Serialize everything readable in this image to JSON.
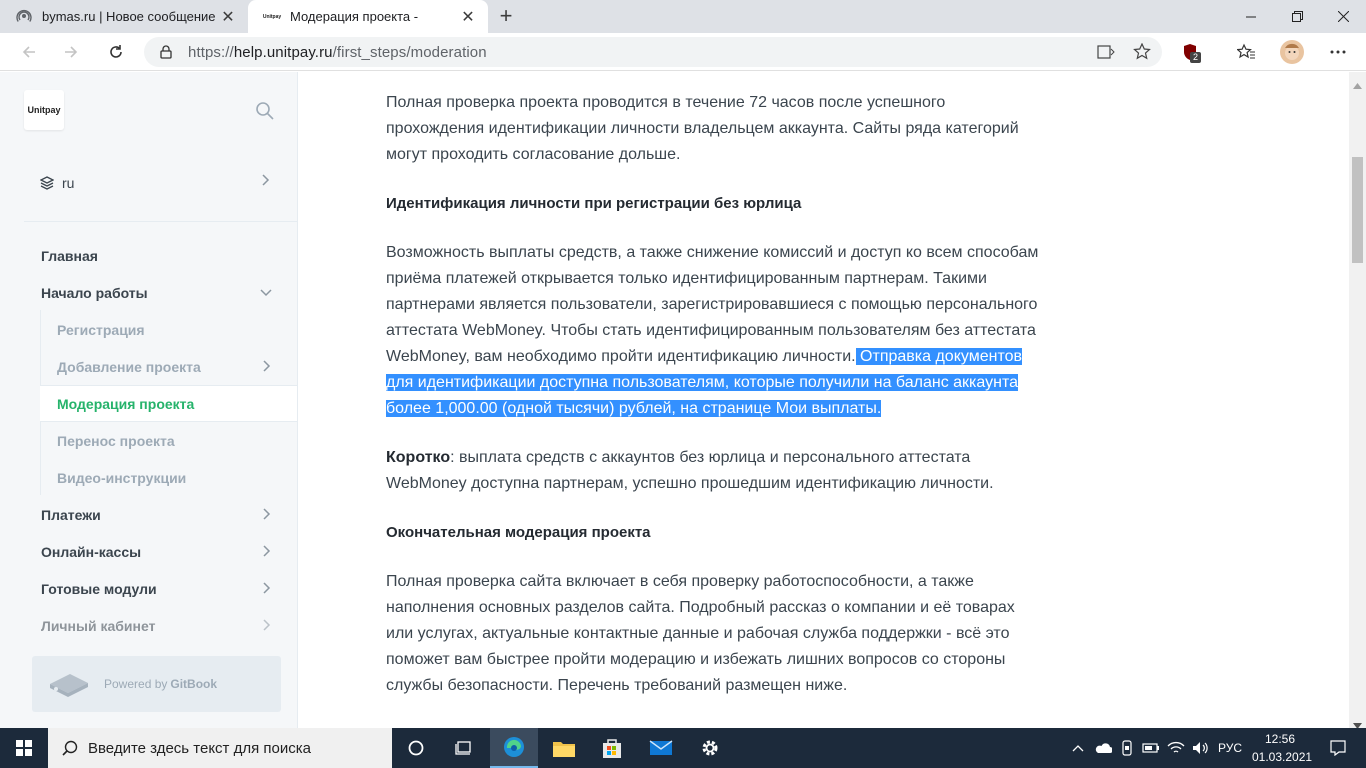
{
  "browser": {
    "tabs": [
      {
        "title": "bymas.ru | Новое сообщение"
      },
      {
        "title": "Модерация проекта -",
        "favicon_text": "Unitpay"
      }
    ],
    "url": {
      "scheme": "https://",
      "host": "help.unitpay.ru",
      "path": "/first_steps/moderation"
    },
    "extension_badge": "2"
  },
  "sidebar": {
    "logo_text": "Unitpay",
    "language": "ru",
    "items": [
      {
        "label": "Главная"
      },
      {
        "label": "Начало работы"
      },
      {
        "label": "Платежи"
      },
      {
        "label": "Онлайн-кассы"
      },
      {
        "label": "Готовые модули"
      },
      {
        "label": "Личный кабинет"
      }
    ],
    "subitems": [
      {
        "label": "Регистрация"
      },
      {
        "label": "Добавление проекта"
      },
      {
        "label": "Модерация проекта"
      },
      {
        "label": "Перенос проекта"
      },
      {
        "label": "Видео-инструкции"
      }
    ],
    "footer": {
      "prefix": "Powered by",
      "brand": "GitBook"
    }
  },
  "content": {
    "p1": "Полная проверка проекта проводится в течение 72 часов после успешного прохождения идентификации личности владельцем аккаунта. Сайты ряда категорий могут проходить согласование дольше.",
    "h1": "Идентификация личности при регистрации без юрлица",
    "p2_plain": "Возможность выплаты средств, а также снижение комиссий и доступ ко всем способам приёма платежей открывается только идентифицированным партнерам. Такими партнерами является пользователи, зарегистрировавшиеся с помощью персонального аттестата WebMoney. Чтобы стать идентифицированным пользователям без аттестата WebMoney, вам необходимо пройти идентификацию личности.",
    "p2_selected": " Отправка документов для идентификации доступна пользователям, которые получили на баланс аккаунта более 1,000.00 (одной тысячи) рублей, на странице Мои выплаты. ",
    "p3_bold": "Коротко",
    "p3_text": ": выплата средств с аккаунтов без юрлица и персонального аттестата WebMoney доступна партнерам, успешно прошедшим идентификацию личности.",
    "h2": "Окончательная модерация проекта",
    "p4": "Полная проверка сайта включает в себя проверку работоспособности, а также наполнения основных разделов сайта. Подробный рассказ о компании и её товарах или услугах, актуальные контактные данные и рабочая служба поддержки - всё это поможет вам быстрее пройти модерацию и избежать лишних вопросов со стороны службы безопасности. Перечень требований размещен ниже."
  },
  "taskbar": {
    "search_placeholder": "Введите здесь текст для поиска",
    "language": "РУС",
    "time": "12:56",
    "date": "01.03.2021"
  },
  "colors": {
    "accent": "#26b36b",
    "selection": "#3390ff",
    "taskbar": "#1c2a3b"
  }
}
